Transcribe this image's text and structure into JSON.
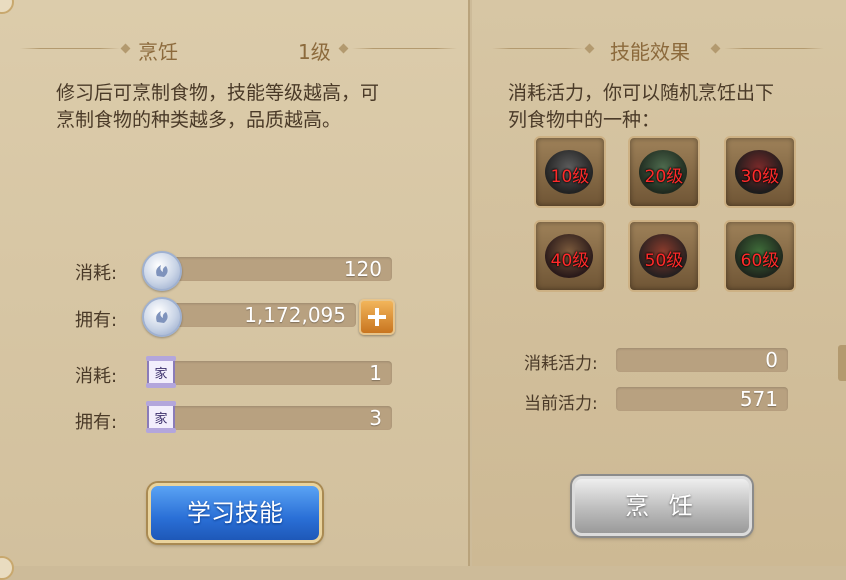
{
  "left": {
    "title": "烹饪",
    "level": "1级",
    "description_line1": "修习后可烹制食物，技能等级越高，可",
    "description_line2": "烹制食物的种类越多，品质越高。",
    "rows": [
      {
        "label": "消耗:",
        "value": "120",
        "icon": "silver-coin-icon"
      },
      {
        "label": "拥有:",
        "value": "1,172,095",
        "icon": "silver-coin-icon"
      },
      {
        "label": "消耗:",
        "value": "1",
        "icon": "family-contribution-scroll-icon",
        "scroll_char": "家"
      },
      {
        "label": "拥有:",
        "value": "3",
        "icon": "family-contribution-scroll-icon",
        "scroll_char": "家"
      }
    ],
    "learn_button": "学习技能"
  },
  "right": {
    "title": "技能效果",
    "description_line1": "消耗活力，你可以随机烹饪出下",
    "description_line2": "列食物中的一种：",
    "foods": [
      {
        "level": "10级"
      },
      {
        "level": "20级"
      },
      {
        "level": "30级"
      },
      {
        "level": "40级"
      },
      {
        "level": "50级"
      },
      {
        "level": "60级"
      }
    ],
    "cost_label": "消耗活力:",
    "cost_value": "0",
    "current_label": "当前活力:",
    "current_value": "571",
    "cook_button": "烹 饪"
  },
  "colors": {
    "panel_bg": "#d8c7a5",
    "title": "#8c6a3c",
    "level_text": "#ff2a2a",
    "blue_button": "#2a6fd6",
    "grey_button": "#bdbdbd",
    "plus_button": "#e08a2e"
  }
}
